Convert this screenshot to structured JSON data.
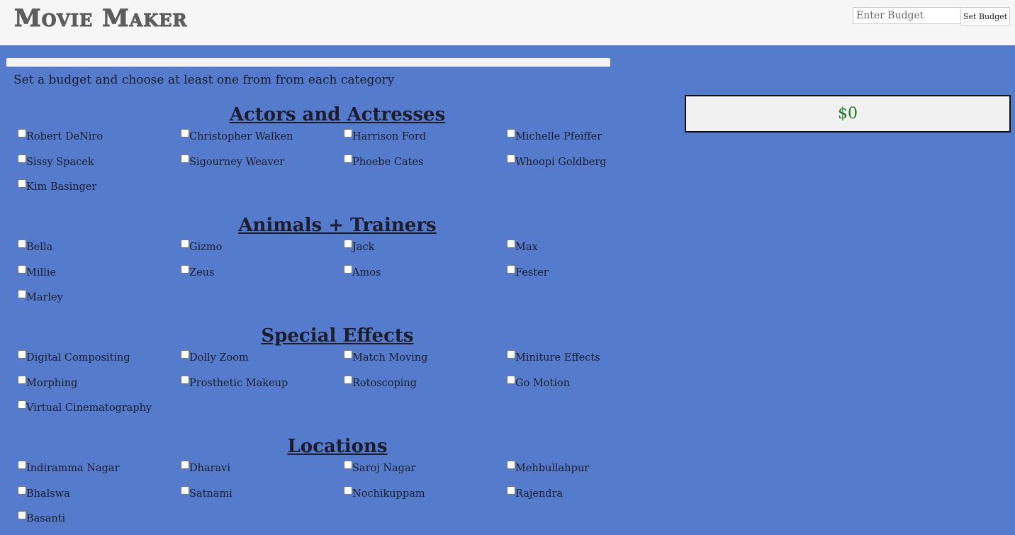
{
  "header": {
    "logo": "Movie Maker",
    "budget_placeholder": "Enter Budget",
    "set_budget_label": "Set Budget"
  },
  "progress": {
    "value": 0
  },
  "instructions": "Set a budget and choose at least one from from each category",
  "total": "$0",
  "colors": {
    "background": "#557ccc",
    "total_text": "#1b7a1b"
  },
  "categories": [
    {
      "title": "Actors and Actresses",
      "items": [
        "Robert DeNiro",
        "Christopher Walken",
        "Harrison Ford",
        "Michelle Pfeiffer",
        "Sissy Spacek",
        "Sigourney Weaver",
        "Phoebe Cates",
        "Whoopi Goldberg",
        "Kim Basinger"
      ]
    },
    {
      "title": "Animals + Trainers",
      "items": [
        "Bella",
        "Gizmo",
        "Jack",
        "Max",
        "Millie",
        "Zeus",
        "Amos",
        "Fester",
        "Marley"
      ]
    },
    {
      "title": "Special Effects",
      "items": [
        "Digital Compositing",
        "Dolly Zoom",
        "Match Moving",
        "Miniture Effects",
        "Morphing",
        "Prosthetic Makeup",
        "Rotoscoping",
        "Go Motion",
        "Virtual Cinematography"
      ]
    },
    {
      "title": "Locations",
      "items": [
        "Indiramma Nagar",
        "Dharavi",
        "Saroj Nagar",
        "Mehbullahpur",
        "Bhalswa",
        "Satnami",
        "Nochikuppam",
        "Rajendra",
        "Basanti"
      ]
    }
  ]
}
